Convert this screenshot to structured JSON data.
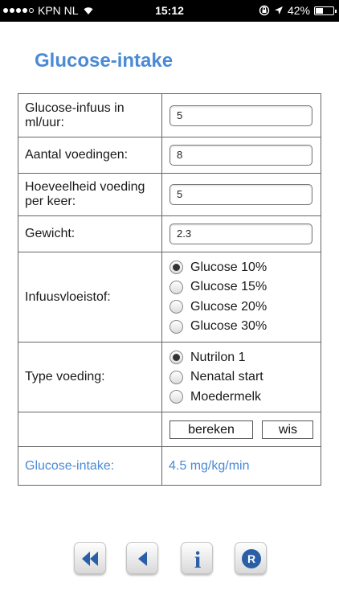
{
  "status_bar": {
    "carrier": "KPN NL",
    "time": "15:12",
    "battery": "42%",
    "battery_level": 0.42,
    "signal_bars": 4,
    "icons": [
      "wifi-icon",
      "orientation-lock-icon",
      "location-icon",
      "battery-icon"
    ]
  },
  "page": {
    "title": "Glucose-intake"
  },
  "form": {
    "infuus": {
      "label": "Glucose-infuus in ml/uur:",
      "value": "5"
    },
    "aantal": {
      "label": "Aantal voedingen:",
      "value": "8"
    },
    "hoeveelheid": {
      "label": "Hoeveelheid voeding per keer:",
      "value": "5"
    },
    "gewicht": {
      "label": "Gewicht:",
      "value": "2.3"
    },
    "infuusvloeistof": {
      "label": "Infuusvloeistof:",
      "options": [
        "Glucose 10%",
        "Glucose 15%",
        "Glucose 20%",
        "Glucose 30%"
      ],
      "selected": "Glucose 10%"
    },
    "type_voeding": {
      "label": "Type voeding:",
      "options": [
        "Nutrilon 1",
        "Nenatal start",
        "Moedermelk"
      ],
      "selected": "Nutrilon 1"
    },
    "buttons": {
      "calculate": "bereken",
      "clear": "wis"
    },
    "result": {
      "label": "Glucose-intake:",
      "value": "4.5 mg/kg/min"
    }
  },
  "nav": {
    "icons": [
      "rewind-icon",
      "back-icon",
      "info-icon",
      "r-icon"
    ],
    "info_glyph": "i",
    "r_glyph": "R"
  },
  "colors": {
    "accent": "#4a8ad6",
    "nav_icon": "#2a5fa8",
    "status_bar": "#000000"
  }
}
